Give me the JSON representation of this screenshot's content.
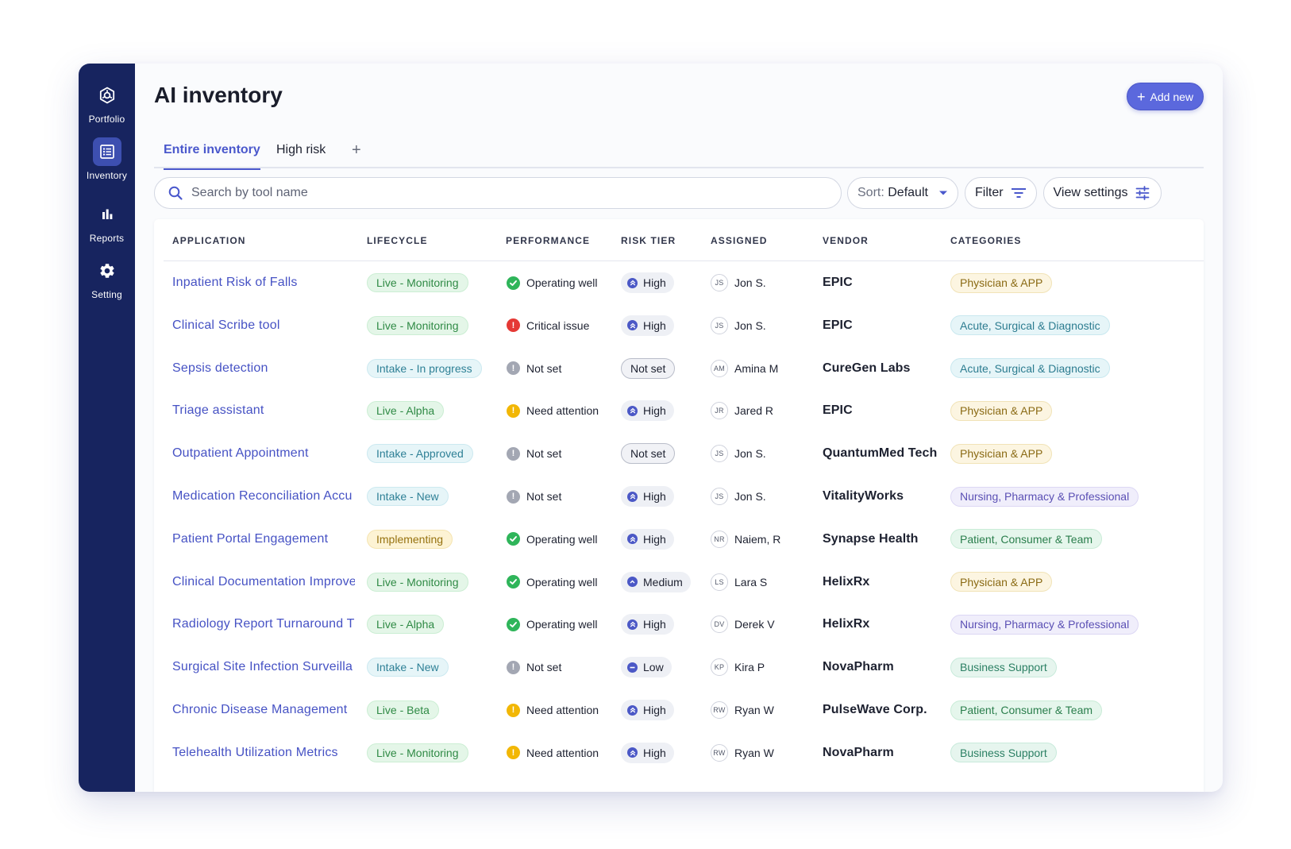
{
  "sidebar": {
    "items": [
      {
        "label": "Portfolio",
        "icon": "portfolio-icon"
      },
      {
        "label": "Inventory",
        "icon": "inventory-icon"
      },
      {
        "label": "Reports",
        "icon": "reports-icon"
      },
      {
        "label": "Setting",
        "icon": "gear-icon"
      }
    ],
    "active": "Inventory"
  },
  "header": {
    "title": "AI inventory",
    "add_label": "Add new"
  },
  "tabs": [
    {
      "label": "Entire inventory",
      "active": true
    },
    {
      "label": "High risk",
      "active": false
    }
  ],
  "toolbar": {
    "search_placeholder": "Search by tool name",
    "sort_prefix": "Sort:",
    "sort_value": "Default",
    "filter_label": "Filter",
    "view_settings_label": "View settings"
  },
  "table": {
    "headers": [
      "APPLICATION",
      "LIFECYCLE",
      "PERFORMANCE",
      "RISK TIER",
      "ASSIGNED",
      "VENDOR",
      "CATEGORIES"
    ],
    "rows": [
      {
        "app": "Inpatient Risk of Falls",
        "lifecycle": "Live - Monitoring",
        "performance": "Operating well",
        "risk": "High",
        "initials": "JS",
        "assigned": "Jon S.",
        "vendor": "EPIC",
        "category": "Physician & APP"
      },
      {
        "app": "Clinical Scribe tool",
        "lifecycle": "Live - Monitoring",
        "performance": "Critical issue",
        "risk": "High",
        "initials": "JS",
        "assigned": "Jon S.",
        "vendor": "EPIC",
        "category": "Acute, Surgical & Diagnostic"
      },
      {
        "app": "Sepsis detection",
        "lifecycle": "Intake - In progress",
        "performance": "Not set",
        "risk": "Not set",
        "initials": "AM",
        "assigned": "Amina M",
        "vendor": "CureGen Labs",
        "category": "Acute, Surgical & Diagnostic"
      },
      {
        "app": "Triage assistant",
        "lifecycle": "Live - Alpha",
        "performance": "Need attention",
        "risk": "High",
        "initials": "JR",
        "assigned": "Jared R",
        "vendor": "EPIC",
        "category": "Physician & APP"
      },
      {
        "app": "Outpatient Appointment",
        "lifecycle": "Intake - Approved",
        "performance": "Not set",
        "risk": "Not set",
        "initials": "JS",
        "assigned": "Jon S.",
        "vendor": "QuantumMed Tech",
        "category": "Physician & APP"
      },
      {
        "app": "Medication Reconciliation Accu",
        "lifecycle": "Intake - New",
        "performance": "Not set",
        "risk": "High",
        "initials": "JS",
        "assigned": "Jon S.",
        "vendor": "VitalityWorks",
        "category": "Nursing, Pharmacy & Professional"
      },
      {
        "app": "Patient Portal Engagement",
        "lifecycle": "Implementing",
        "performance": "Operating well",
        "risk": "High",
        "initials": "NR",
        "assigned": "Naiem, R",
        "vendor": "Synapse Health",
        "category": "Patient, Consumer & Team"
      },
      {
        "app": "Clinical Documentation Improve",
        "lifecycle": "Live - Monitoring",
        "performance": "Operating well",
        "risk": "Medium",
        "initials": "LS",
        "assigned": "Lara S",
        "vendor": "HelixRx",
        "category": "Physician & APP"
      },
      {
        "app": "Radiology Report Turnaround Ti",
        "lifecycle": "Live - Alpha",
        "performance": "Operating well",
        "risk": "High",
        "initials": "DV",
        "assigned": "Derek V",
        "vendor": "HelixRx",
        "category": "Nursing, Pharmacy & Professional"
      },
      {
        "app": "Surgical Site Infection Surveilla",
        "lifecycle": "Intake - New",
        "performance": "Not set",
        "risk": "Low",
        "initials": "KP",
        "assigned": "Kira P",
        "vendor": "NovaPharm",
        "category": "Business Support"
      },
      {
        "app": "Chronic Disease Management",
        "lifecycle": "Live - Beta",
        "performance": "Need attention",
        "risk": "High",
        "initials": "RW",
        "assigned": "Ryan W",
        "vendor": "PulseWave Corp.",
        "category": "Patient, Consumer & Team"
      },
      {
        "app": "Telehealth Utilization Metrics",
        "lifecycle": "Live - Monitoring",
        "performance": "Need attention",
        "risk": "High",
        "initials": "RW",
        "assigned": "Ryan W",
        "vendor": "NovaPharm",
        "category": "Business Support"
      }
    ]
  },
  "colors": {
    "sidebar_bg": "#17245f",
    "accent": "#5b68dd",
    "link": "#4652c4",
    "operating_well": "#2fb55a",
    "critical_issue": "#e53935",
    "need_attention": "#f2b705",
    "not_set": "#a3a7b3"
  }
}
